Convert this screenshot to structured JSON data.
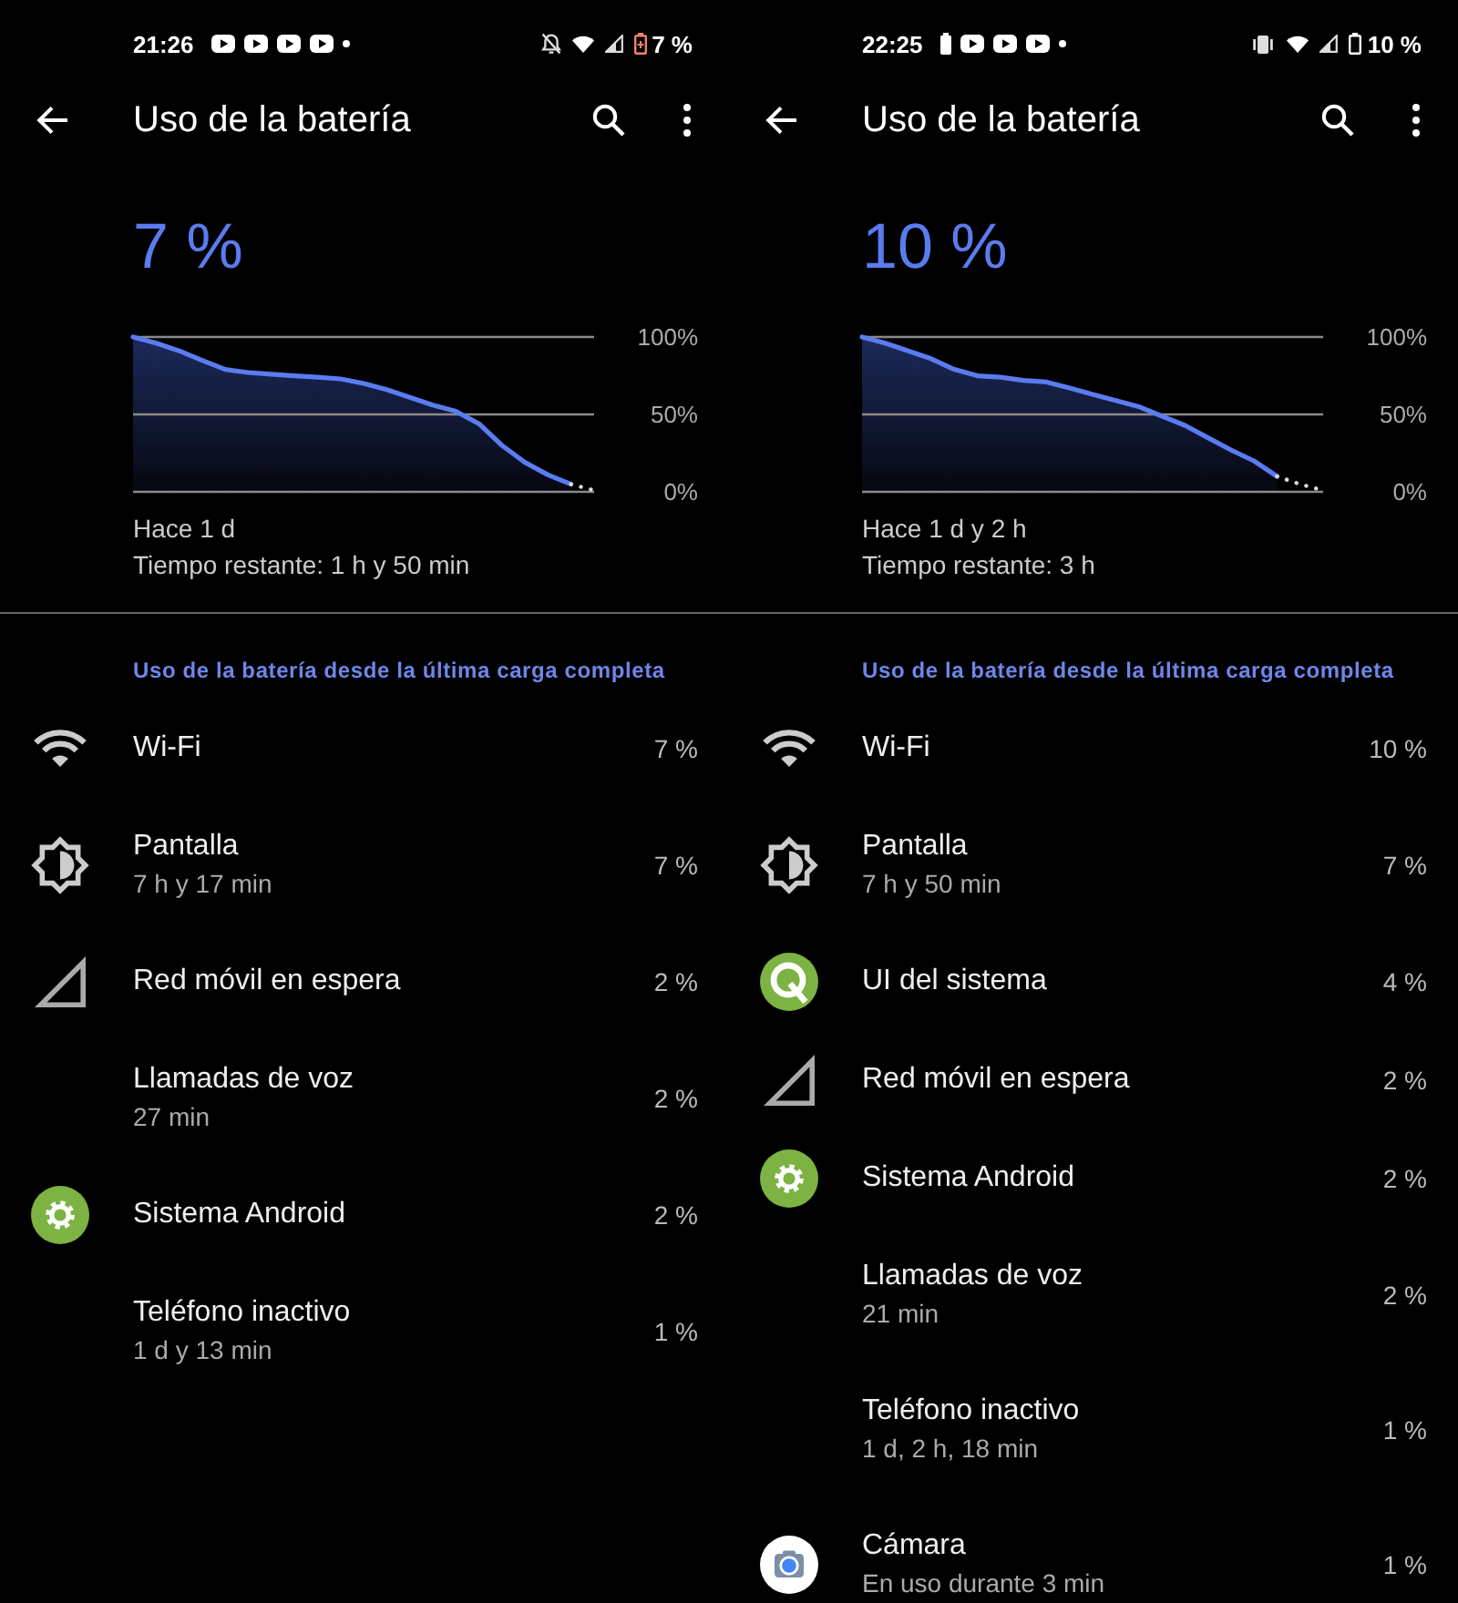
{
  "screens": [
    {
      "status_bar": {
        "time": "21:26",
        "notification_icons": [
          {
            "kind": "video"
          },
          {
            "kind": "video"
          },
          {
            "kind": "video"
          },
          {
            "kind": "video"
          },
          {
            "kind": "more"
          }
        ],
        "system_icons": [
          {
            "kind": "mute"
          },
          {
            "kind": "wifi"
          },
          {
            "kind": "signal"
          },
          {
            "kind": "battery-saver"
          }
        ],
        "battery_text": "7 %"
      },
      "app_bar": {
        "title": "Uso de la batería"
      },
      "battery": {
        "percentage": "7 %",
        "chart_data": {
          "type": "area",
          "categories": [
            null,
            null,
            null,
            null,
            null,
            null,
            null,
            null,
            null,
            null,
            null,
            null,
            null,
            null,
            null,
            null,
            null,
            null,
            null,
            null,
            null
          ],
          "ylim": [
            0,
            100
          ],
          "yticks": [
            {
              "value": 100,
              "label": "100%"
            },
            {
              "value": 50,
              "label": "50%"
            },
            {
              "value": 0,
              "label": "0%"
            }
          ],
          "series": [
            {
              "color": "#5b7bf0",
              "line_style": "solid",
              "values": [
                100,
                96,
                91,
                85,
                79,
                77,
                76,
                75,
                74,
                73,
                70,
                66,
                61,
                56,
                52,
                44,
                30,
                19,
                11,
                5,
                null
              ]
            },
            {
              "type": "line",
              "color": "#dddddd",
              "line_style": "dotted",
              "values": [
                null,
                null,
                null,
                null,
                null,
                null,
                null,
                null,
                null,
                null,
                null,
                null,
                null,
                null,
                null,
                null,
                null,
                null,
                null,
                5,
                1
              ]
            }
          ]
        },
        "since": "Hace 1 d",
        "remaining": "Tiempo restante: 1 h y 50 min"
      },
      "section_header": "Uso de la batería desde la última carga completa",
      "items": [
        {
          "kind": "wifi",
          "title": "Wi-Fi",
          "percent": "7 %"
        },
        {
          "kind": "display",
          "title": "Pantalla",
          "detail": "7 h y 17 min",
          "percent": "7 %"
        },
        {
          "kind": "cellular",
          "title": "Red móvil en espera",
          "percent": "2 %"
        },
        {
          "kind": "none",
          "title": "Llamadas de voz",
          "detail": "27 min",
          "percent": "2 %"
        },
        {
          "kind": "android-system",
          "title": "Sistema Android",
          "percent": "2 %"
        },
        {
          "kind": "none",
          "title": "Teléfono inactivo",
          "detail": "1 d y 13 min",
          "percent": "1 %"
        }
      ]
    },
    {
      "status_bar": {
        "time": "22:25",
        "notification_icons": [
          {
            "kind": "battery"
          },
          {
            "kind": "video"
          },
          {
            "kind": "video"
          },
          {
            "kind": "video"
          },
          {
            "kind": "more"
          }
        ],
        "system_icons": [
          {
            "kind": "vibrate"
          },
          {
            "kind": "wifi"
          },
          {
            "kind": "signal"
          },
          {
            "kind": "battery"
          }
        ],
        "battery_text": "10 %"
      },
      "app_bar": {
        "title": "Uso de la batería"
      },
      "battery": {
        "percentage": "10 %",
        "chart_data": {
          "type": "area",
          "categories": [
            null,
            null,
            null,
            null,
            null,
            null,
            null,
            null,
            null,
            null,
            null,
            null,
            null,
            null,
            null,
            null,
            null,
            null,
            null,
            null,
            null
          ],
          "ylim": [
            0,
            100
          ],
          "yticks": [
            {
              "value": 100,
              "label": "100%"
            },
            {
              "value": 50,
              "label": "50%"
            },
            {
              "value": 0,
              "label": "0%"
            }
          ],
          "series": [
            {
              "color": "#5b7bf0",
              "line_style": "solid",
              "values": [
                100,
                96,
                91,
                86,
                79,
                75,
                74,
                72,
                71,
                67,
                63,
                59,
                55,
                49,
                43,
                35,
                27,
                20,
                10,
                null,
                null
              ]
            },
            {
              "type": "line",
              "color": "#dddddd",
              "line_style": "dotted",
              "values": [
                null,
                null,
                null,
                null,
                null,
                null,
                null,
                null,
                null,
                null,
                null,
                null,
                null,
                null,
                null,
                null,
                null,
                null,
                10,
                5,
                1
              ]
            }
          ]
        },
        "since": "Hace 1 d y 2 h",
        "remaining": "Tiempo restante: 3 h"
      },
      "section_header": "Uso de la batería desde la última carga completa",
      "items": [
        {
          "kind": "wifi",
          "title": "Wi-Fi",
          "percent": "10 %"
        },
        {
          "kind": "display",
          "title": "Pantalla",
          "detail": "7 h y 50 min",
          "percent": "7 %"
        },
        {
          "kind": "system-ui",
          "title": "UI del sistema",
          "percent": "4 %"
        },
        {
          "kind": "cellular",
          "title": "Red móvil en espera",
          "percent": "2 %"
        },
        {
          "kind": "android-system",
          "title": "Sistema Android",
          "percent": "2 %"
        },
        {
          "kind": "none",
          "title": "Llamadas de voz",
          "detail": "21 min",
          "percent": "2 %"
        },
        {
          "kind": "none",
          "title": "Teléfono inactivo",
          "detail": "1 d, 2 h, 18 min",
          "percent": "1 %"
        },
        {
          "kind": "camera",
          "title": "Cámara",
          "detail": "En uso durante 3 min",
          "percent": "1 %"
        }
      ]
    }
  ]
}
